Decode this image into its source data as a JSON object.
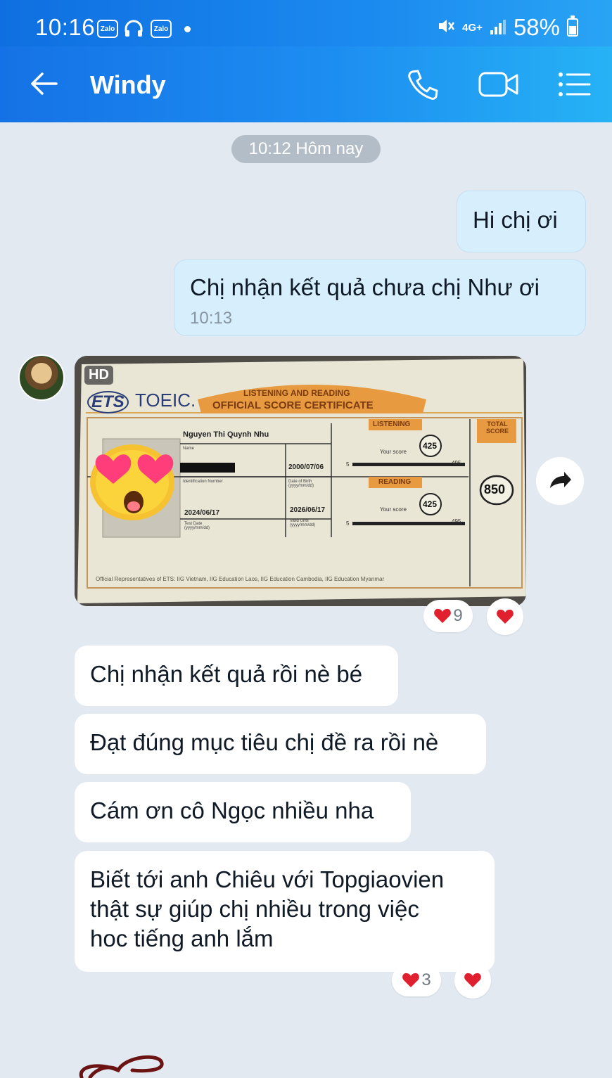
{
  "status_bar": {
    "time": "10:16",
    "app_icons": [
      "Zalo",
      "Zalo"
    ],
    "network": "4G+",
    "battery": "58%"
  },
  "header": {
    "contact_name": "Windy",
    "icons": [
      "back-arrow-icon",
      "phone-icon",
      "video-call-icon",
      "menu-list-icon"
    ]
  },
  "chat": {
    "date_pill": "10:12 Hôm nay",
    "messages": [
      {
        "side": "sent",
        "text": "Hi chị ơi"
      },
      {
        "side": "sent",
        "text": "Chị nhận kết quả chưa chị Như ơi",
        "time": "10:13"
      },
      {
        "side": "recv",
        "type": "image",
        "badge": "HD",
        "certificate": {
          "brand_ets": "ETS",
          "brand_toeic": "TOEIC.",
          "title_line1": "LISTENING AND READING",
          "title_line2": "OFFICIAL SCORE CERTIFICATE",
          "name": "Nguyen Thi Quynh Nhu",
          "name_label": "Name",
          "dob": "2000/07/06",
          "dob_label": "Date of Birth (yyyy/mm/dd)",
          "id_label": "Identification Number",
          "test_date": "2024/06/17",
          "test_date_label": "Test Date (yyyy/mm/dd)",
          "valid_until": "2026/06/17",
          "valid_label": "Valid Until (yyyy/mm/dd)",
          "listening_label": "LISTENING",
          "reading_label": "READING",
          "your_score": "Your score",
          "listening_score": "425",
          "reading_score": "425",
          "scale_min": "5",
          "scale_max": "495",
          "total_label": "TOTAL SCORE",
          "total_score": "850",
          "footer": "Official Representatives of ETS: IIG Vietnam, IIG Education Laos, IIG Education Cambodia, IIG Education Myanmar"
        },
        "reaction_count": "9"
      },
      {
        "side": "recv",
        "text": "Chị nhận kết quả rồi nè bé"
      },
      {
        "side": "recv",
        "text": "Đạt đúng mục tiêu chị đề ra rồi nè"
      },
      {
        "side": "recv",
        "text": "Cám ơn cô Ngọc nhiều nha"
      },
      {
        "side": "recv",
        "text_lines": [
          "Biết tới anh Chiêu với Topgiaovien",
          "thật sự giúp chị nhiều trong việc",
          "hoc tiếng anh lắm"
        ],
        "reaction_count": "3"
      }
    ]
  },
  "colors": {
    "header_start": "#1572e6",
    "header_end": "#26b2f5",
    "chat_bg": "#e2e9f1",
    "sent_bubble": "#d7effd",
    "recv_bubble": "#ffffff",
    "heart": "#e0202f"
  }
}
